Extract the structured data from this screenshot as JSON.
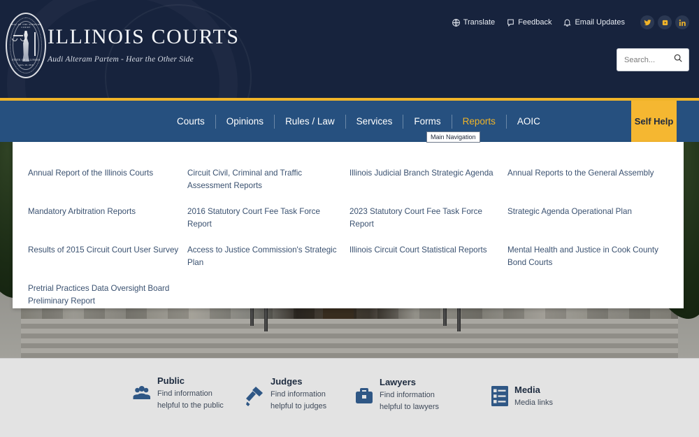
{
  "header": {
    "brand_title": "ILLINOIS COURTS",
    "brand_tagline": "Audi Alteram Partem - Hear the Other Side",
    "seal": {
      "text_top": "SEAL OF THE SUPREME COURT",
      "text_bottom": "STATE OF ILLINOIS",
      "text_date": "AUG. 26, 1818"
    },
    "utility": [
      {
        "label": "Translate",
        "icon": "globe-icon"
      },
      {
        "label": "Feedback",
        "icon": "speech-bubble-icon"
      },
      {
        "label": "Email Updates",
        "icon": "bell-icon"
      }
    ],
    "social": [
      {
        "name": "twitter-icon"
      },
      {
        "name": "youtube-icon"
      },
      {
        "name": "linkedin-icon"
      }
    ],
    "search": {
      "placeholder": "Search...",
      "value": "",
      "icon": "search-icon"
    }
  },
  "nav": {
    "items": [
      {
        "label": "Courts",
        "active": false
      },
      {
        "label": "Opinions",
        "active": false
      },
      {
        "label": "Rules / Law",
        "active": false
      },
      {
        "label": "Services",
        "active": false
      },
      {
        "label": "Forms",
        "active": false
      },
      {
        "label": "Reports",
        "active": true
      },
      {
        "label": "AOIC",
        "active": false
      }
    ],
    "self_help_label": "Self Help",
    "tooltip": "Main Navigation",
    "accent_color": "#f0b429",
    "bar_color": "#26507f"
  },
  "dropdown": {
    "open_for": "Reports",
    "links": [
      "Annual Report of the Illinois Courts",
      "Circuit Civil, Criminal and Traffic Assessment Reports",
      "Illinois Judicial Branch Strategic Agenda",
      "Annual Reports to the General Assembly",
      "Mandatory Arbitration Reports",
      "2016 Statutory Court Fee Task Force Report",
      "2023 Statutory Court Fee Task Force Report",
      "Strategic Agenda Operational Plan",
      "Results of 2015 Circuit Court User Survey",
      "Access to Justice Commission's Strategic Plan",
      "Illinois Circuit Court Statistical Reports",
      "Mental Health and Justice in Cook County Bond Courts",
      "Pretrial Practices Data Oversight Board Preliminary Report",
      "",
      "",
      ""
    ]
  },
  "quick_links": [
    {
      "title": "Public",
      "desc": "Find information helpful to the public",
      "icon": "people-group-icon"
    },
    {
      "title": "Judges",
      "desc": "Find information helpful to judges",
      "icon": "gavel-icon"
    },
    {
      "title": "Lawyers",
      "desc": "Find information helpful to lawyers",
      "icon": "briefcase-icon"
    },
    {
      "title": "Media",
      "desc": "Media links",
      "icon": "list-icon"
    }
  ]
}
